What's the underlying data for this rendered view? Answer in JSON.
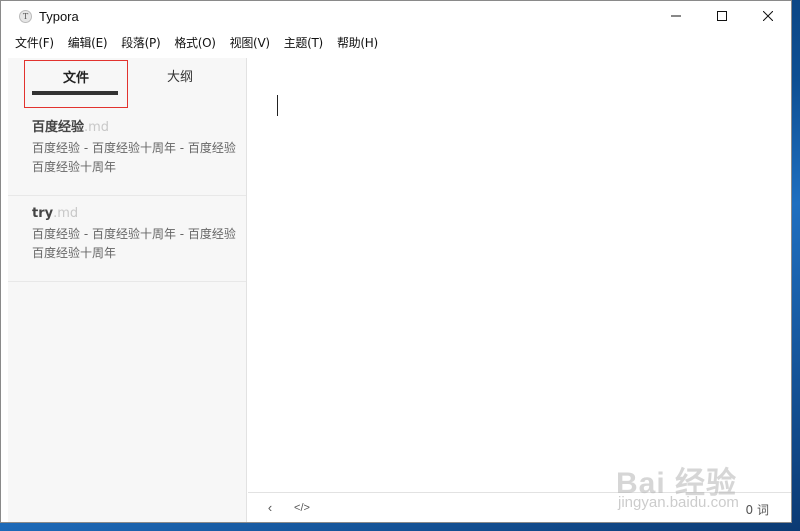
{
  "window": {
    "title": "Typora",
    "icon_glyph": "T",
    "controls": {
      "minimize": "—",
      "maximize": "☐",
      "close": "✕"
    }
  },
  "menubar": {
    "items": [
      "文件(F)",
      "编辑(E)",
      "段落(P)",
      "格式(O)",
      "视图(V)",
      "主题(T)",
      "帮助(H)"
    ]
  },
  "sidebar": {
    "tabs": [
      {
        "label": "文件",
        "active": true
      },
      {
        "label": "大纲",
        "active": false
      }
    ],
    "files": [
      {
        "name": "百度经验",
        "ext": ".md",
        "snippet": "百度经验 - 百度经验十周年 - 百度经验 百度经验十周年"
      },
      {
        "name": "try",
        "ext": ".md",
        "snippet": "百度经验 - 百度经验十周年 - 百度经验 百度经验十周年"
      }
    ]
  },
  "statusbar": {
    "back_icon": "‹",
    "source_icon": "</>",
    "word_count": "0 词"
  },
  "watermark": {
    "logo": "Bai 经验",
    "url": "jingyan.baidu.com"
  },
  "colors": {
    "highlight_border": "#e2332e",
    "sidebar_bg": "#f7f7f7",
    "tab_underline": "#333333"
  }
}
